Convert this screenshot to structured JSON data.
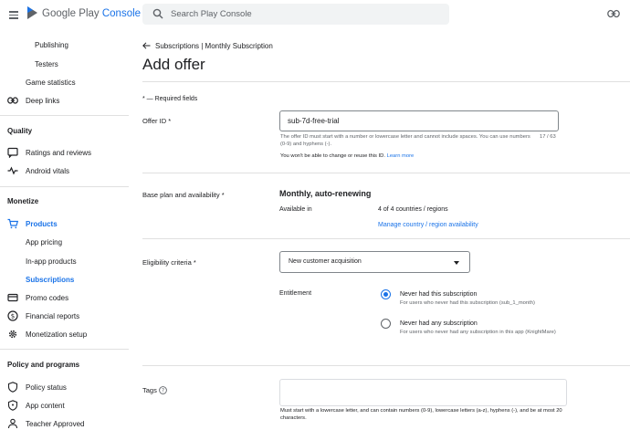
{
  "header": {
    "brand_prefix": "Google Play",
    "brand_suffix": "Console",
    "search_placeholder": "Search Play Console"
  },
  "sidebar": {
    "items_top": [
      {
        "label": "Publishing"
      },
      {
        "label": "Testers"
      }
    ],
    "game_statistics": "Game statistics",
    "deep_links": "Deep links",
    "quality_heading": "Quality",
    "ratings": "Ratings and reviews",
    "vitals": "Android vitals",
    "monetize_heading": "Monetize",
    "products": "Products",
    "app_pricing": "App pricing",
    "in_app": "In-app products",
    "subscriptions": "Subscriptions",
    "promo": "Promo codes",
    "financial": "Financial reports",
    "monetization_setup": "Monetization setup",
    "policy_heading": "Policy and programs",
    "policy_status": "Policy status",
    "app_content": "App content",
    "teacher": "Teacher Approved"
  },
  "main": {
    "breadcrumb": "Subscriptions | Monthly Subscription",
    "title": "Add offer",
    "required_note": "* — Required fields",
    "offer_id": {
      "label": "Offer ID *",
      "value": "sub-7d-free-trial",
      "helper": "The offer ID must start with a number or lowercase letter and cannot include spaces. You can use numbers (0-9) and hyphens (-).",
      "counter": "17 / 63",
      "note": "You won't be able to change or reuse this ID.",
      "learn_more": "Learn more"
    },
    "base_plan": {
      "label": "Base plan and availability *",
      "title": "Monthly, auto-renewing",
      "available_label": "Available in",
      "available_value": "4 of 4 countries / regions",
      "manage_link": "Manage country / region availability"
    },
    "eligibility": {
      "label": "Eligibility criteria *",
      "selected": "New customer acquisition",
      "entitlement_label": "Entitlement",
      "options": [
        {
          "title": "Never had this subscription",
          "desc": "For users who never had this subscription (sub_1_month)",
          "checked": true
        },
        {
          "title": "Never had any subscription",
          "desc": "For users who never had any subscription in this app (KnightMare)",
          "checked": false
        }
      ]
    },
    "tags": {
      "label": "Tags",
      "helper": "Must start with a lowercase letter, and can contain numbers (0-9), lowercase letters (a-z), hyphens (-), and be at most 20 characters."
    }
  },
  "colors": {
    "accent": "#1a73e8",
    "text": "#202124",
    "muted": "#5f6368"
  }
}
